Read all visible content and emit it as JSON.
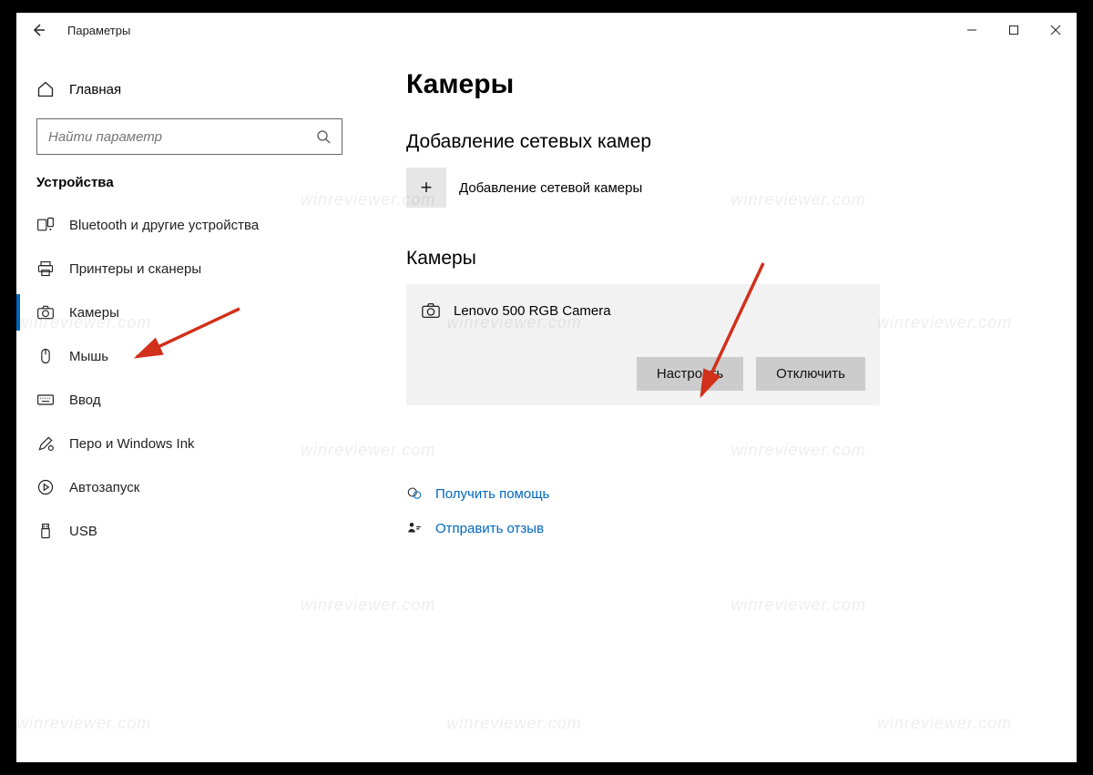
{
  "window": {
    "title": "Параметры"
  },
  "sidebar": {
    "home_label": "Главная",
    "search_placeholder": "Найти параметр",
    "section_label": "Устройства",
    "items": [
      {
        "label": "Bluetooth и другие устройства",
        "icon": "bluetooth"
      },
      {
        "label": "Принтеры и сканеры",
        "icon": "printer"
      },
      {
        "label": "Камеры",
        "icon": "camera",
        "active": true
      },
      {
        "label": "Мышь",
        "icon": "mouse"
      },
      {
        "label": "Ввод",
        "icon": "keyboard"
      },
      {
        "label": "Перо и Windows Ink",
        "icon": "pen"
      },
      {
        "label": "Автозапуск",
        "icon": "autoplay"
      },
      {
        "label": "USB",
        "icon": "usb"
      }
    ]
  },
  "content": {
    "title": "Камеры",
    "add_section_heading": "Добавление сетевых камер",
    "add_button_label": "Добавление сетевой камеры",
    "list_heading": "Камеры",
    "device_name": "Lenovo 500 RGB Camera",
    "configure_label": "Настроить",
    "disable_label": "Отключить"
  },
  "help": {
    "get_help": "Получить помощь",
    "feedback": "Отправить отзыв"
  },
  "watermark": "winreviewer.com"
}
